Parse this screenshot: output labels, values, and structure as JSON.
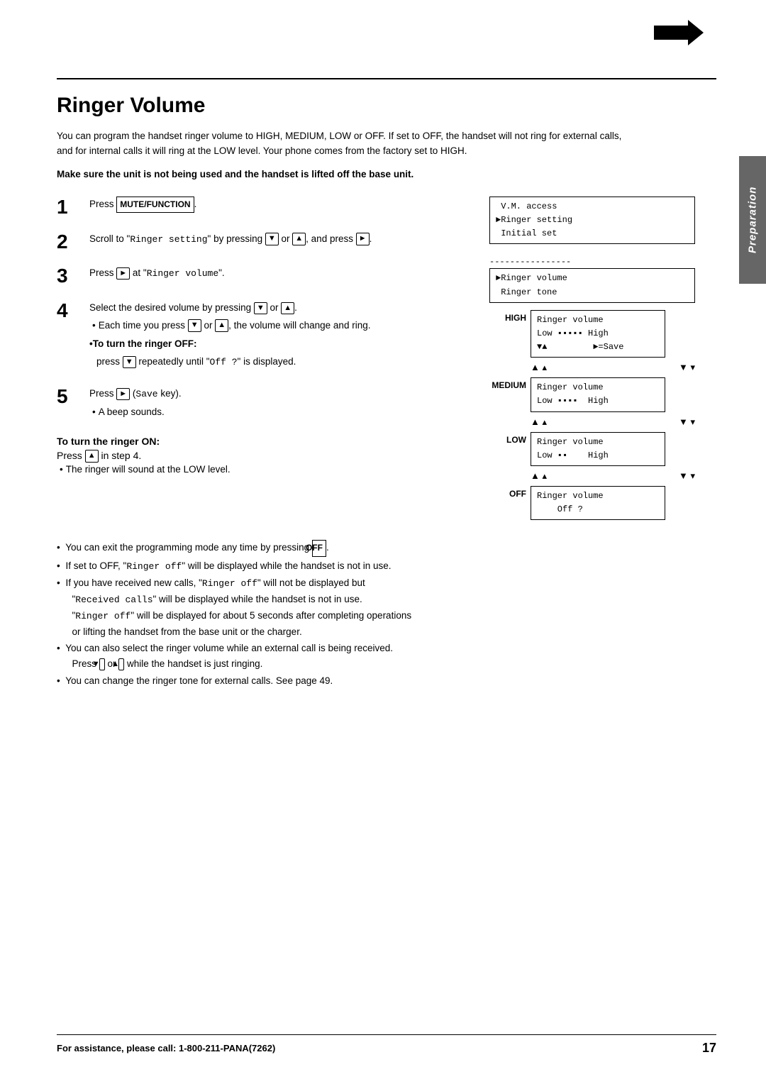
{
  "page": {
    "title": "Ringer Volume",
    "sidebar_tab": "Preparation"
  },
  "top_arrow": "→",
  "intro": {
    "paragraph": "You can program the handset ringer volume to HIGH, MEDIUM, LOW or OFF. If set to OFF, the handset will not ring for external calls, and for internal calls it will ring at the LOW level. Your phone comes from the factory set to HIGH.",
    "warning": "Make sure the unit is not being used and the handset is lifted off the base unit."
  },
  "steps": [
    {
      "number": "1",
      "text": "Press",
      "button": "MUTE/FUNCTION",
      "suffix": "."
    },
    {
      "number": "2",
      "text1": "Scroll to \"",
      "mono1": "Ringer setting",
      "text2": "\" by pressing",
      "buttons": [
        "▼",
        "▲"
      ],
      "text3": ", and press",
      "button3": "►",
      "suffix": "."
    },
    {
      "number": "3",
      "text1": "Press",
      "button1": "►",
      "text2": " at \"",
      "mono2": "Ringer volume",
      "suffix": "\"."
    },
    {
      "number": "4",
      "text1": "Select the desired volume by pressing",
      "buttons": [
        "▼",
        "▲"
      ],
      "suffix": ".",
      "bullets": [
        {
          "text1": "Each time you press",
          "buttons": [
            "▼",
            "▲"
          ],
          "text2": ", the volume will change and ring."
        }
      ],
      "bold_sub": "•To turn the ringer OFF:",
      "sub_text1": "press",
      "sub_btn": "▼",
      "sub_text2": "repeatedly until \"",
      "sub_mono": "Off ?",
      "sub_text3": "\" is displayed."
    },
    {
      "number": "5",
      "text1": "Press",
      "button1": "►",
      "text2": " (",
      "mono2": "Save",
      "text3": " key).",
      "bullet": "•A beep sounds."
    }
  ],
  "turn_on": {
    "heading": "To turn the ringer ON:",
    "line1": "Press",
    "btn": "▲",
    "line2": " in step 4.",
    "note": "•The ringer will sound at the LOW level."
  },
  "lcd_displays": {
    "top_box": {
      "line1": " V.M. access",
      "line2": "►Ringer setting",
      "line3": " Initial set"
    },
    "divider": "----------------",
    "second_box": {
      "line1": "►Ringer volume",
      "line2": " Ringer tone"
    },
    "high_label": "HIGH",
    "high_box": {
      "line1": "Ringer volume",
      "line2": "Low ▪▪▪▪▪ High",
      "line3": "▼▲         ►=Save"
    },
    "high_nav": "",
    "medium_label": "MEDIUM",
    "medium_box": {
      "line1": "Ringer volume",
      "line2": "Low ▪▪▪▪  High"
    },
    "medium_nav": "▲▴         ▼▾",
    "low_label": "LOW",
    "low_box": {
      "line1": "Ringer volume",
      "line2": "Low ▪▪   High"
    },
    "low_nav": "▲▴         ▼▾",
    "off_label": "OFF",
    "off_box": {
      "line1": "Ringer volume",
      "line2": "    Off ?"
    }
  },
  "bottom_notes": [
    "You can exit the programming mode any time by pressing OFF .",
    "If set to OFF, \"Ringer off\" will be displayed while the handset is not in use.",
    "If you have received new calls, \"Ringer off\" will not be displayed but \"Received calls\" will be displayed while the handset is not in use. \"Ringer off\" will be displayed for about 5 seconds after completing operations or lifting the handset from the base unit or the charger.",
    "You can also select the ringer volume while an external call is being received. Press ▼ or ▲ while the handset is just ringing.",
    "You can change the ringer tone for external calls. See page 49."
  ],
  "footer": {
    "left": "For assistance, please call: 1-800-211-PANA(7262)",
    "right": "17"
  }
}
